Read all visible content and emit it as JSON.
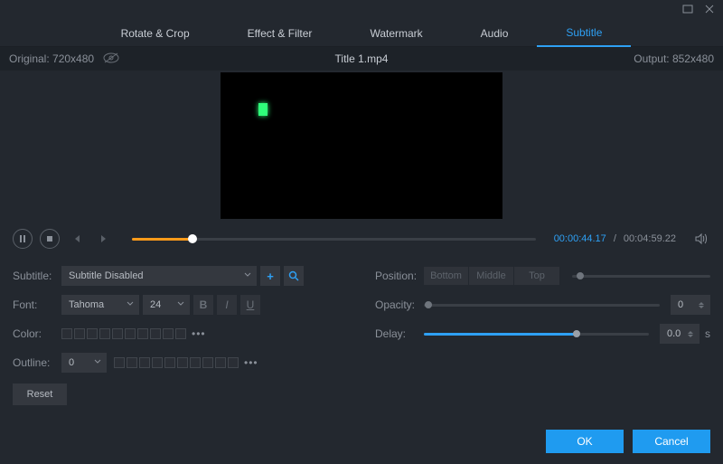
{
  "tabs": {
    "rotate": "Rotate & Crop",
    "effect": "Effect & Filter",
    "watermark": "Watermark",
    "audio": "Audio",
    "subtitle": "Subtitle"
  },
  "preview": {
    "original_label": "Original:",
    "original_res": "720x480",
    "title": "Title 1.mp4",
    "output_label": "Output:",
    "output_res": "852x480"
  },
  "transport": {
    "current": "00:00:44.17",
    "sep": "/",
    "duration": "00:04:59.22"
  },
  "left": {
    "subtitle_label": "Subtitle:",
    "subtitle_value": "Subtitle Disabled",
    "font_label": "Font:",
    "font_value": "Tahoma",
    "size_value": "24",
    "bold": "B",
    "italic": "I",
    "underline": "U",
    "color_label": "Color:",
    "outline_label": "Outline:",
    "outline_value": "0",
    "reset": "Reset",
    "more": "•••"
  },
  "right": {
    "position_label": "Position:",
    "pos_bottom": "Bottom",
    "pos_middle": "Middle",
    "pos_top": "Top",
    "opacity_label": "Opacity:",
    "opacity_value": "0",
    "delay_label": "Delay:",
    "delay_value": "0.0",
    "delay_unit": "s"
  },
  "footer": {
    "ok": "OK",
    "cancel": "Cancel"
  },
  "colors": {
    "accent": "#2ea0f4",
    "seek": "#ff9b1a"
  }
}
